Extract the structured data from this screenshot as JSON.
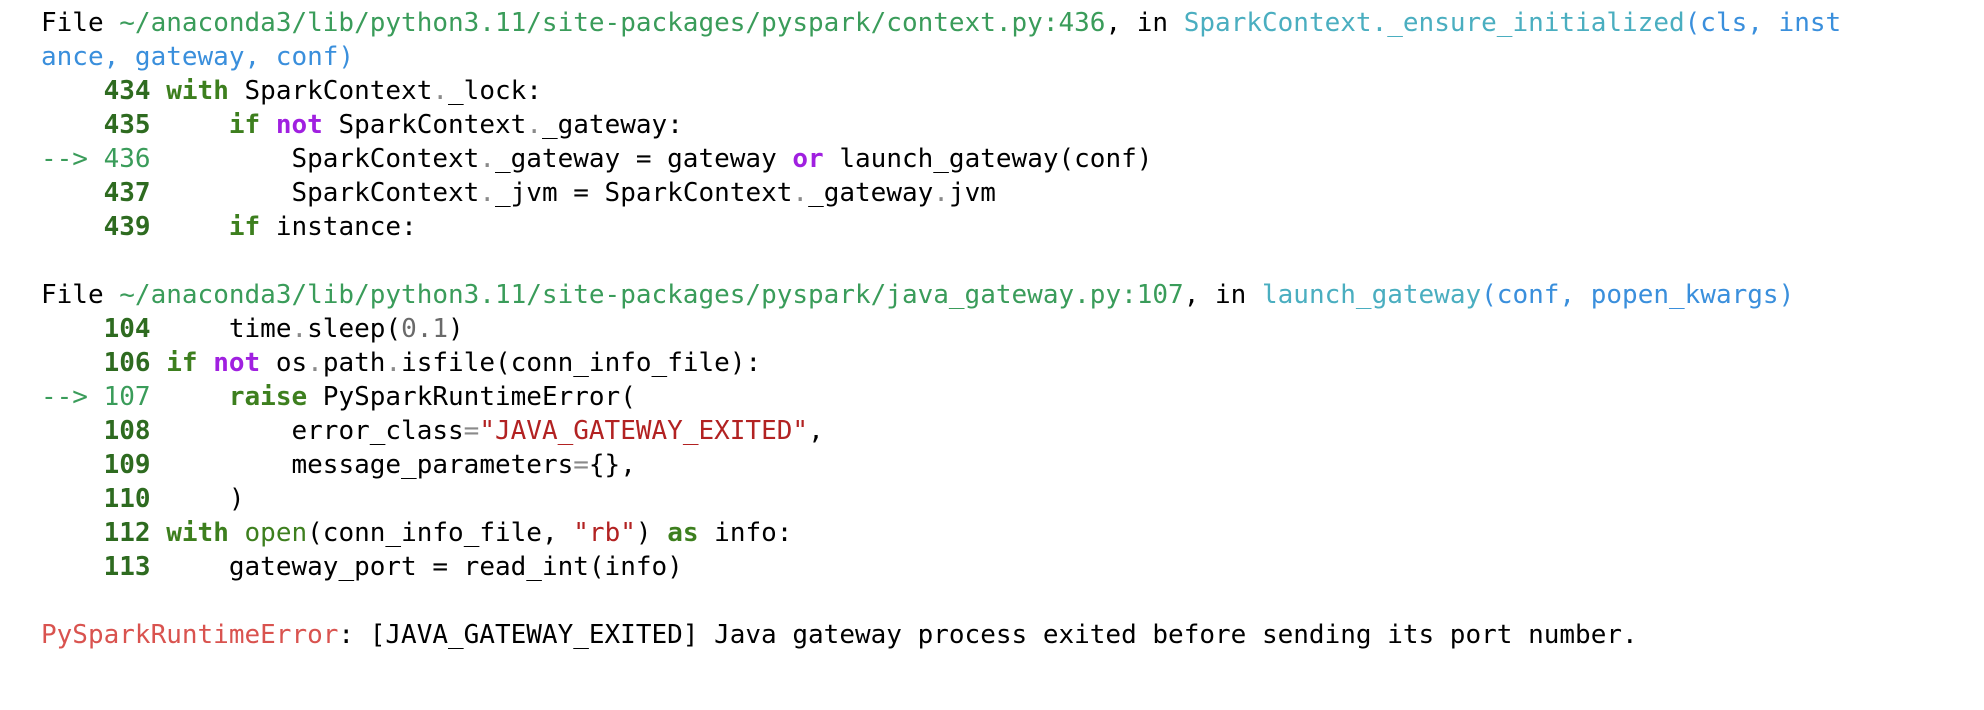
{
  "frame1": {
    "file_label": "File",
    "path": "~/anaconda3/lib/python3.11/site-packages/pyspark/context.py:436",
    "in_label": ", in",
    "func": "SparkContext._ensure_initialized",
    "args_part1": "(cls, inst",
    "args_part2": "ance, gateway, conf)",
    "lines": {
      "l434": {
        "no": "434",
        "kw": "with",
        "rest": " SparkContext",
        "dot": ".",
        "rest2": "_lock:"
      },
      "l435": {
        "no": "435",
        "kw": "if",
        "kw2": "not",
        "rest": " SparkContext",
        "dot": ".",
        "rest2": "_gateway:"
      },
      "l436": {
        "arrow": "--> 436",
        "a": "SparkContext",
        "dot": ".",
        "b": "_gateway = gateway",
        "kw": "or",
        "c": " launch_gateway(conf)"
      },
      "l437": {
        "no": "437",
        "a": "SparkContext",
        "dot1": ".",
        "b": "_jvm = SparkContext",
        "dot2": ".",
        "c": "_gateway",
        "dot3": ".",
        "d": "jvm"
      },
      "l439": {
        "no": "439",
        "kw": "if",
        "rest": " instance:"
      }
    }
  },
  "frame2": {
    "file_label": "File",
    "path": "~/anaconda3/lib/python3.11/site-packages/pyspark/java_gateway.py:107",
    "in_label": ", in",
    "func": "launch_gateway",
    "args": "(conf, popen_kwargs)",
    "lines": {
      "l104": {
        "no": "104",
        "a": "time",
        "dot": ".",
        "b": "sleep(",
        "num": "0.1",
        "c": ")"
      },
      "l106": {
        "no": "106",
        "kw": "if",
        "kw2": "not",
        "a": " os",
        "dot1": ".",
        "b": "path",
        "dot2": ".",
        "c": "isfile(conn_info_file):"
      },
      "l107": {
        "arrow": "--> 107",
        "kw": "raise",
        "rest": " PySparkRuntimeError("
      },
      "l108": {
        "no": "108",
        "a": "error_class",
        "eq": "=",
        "str": "\"JAVA_GATEWAY_EXITED\"",
        "b": ","
      },
      "l109": {
        "no": "109",
        "a": "message_parameters",
        "eq": "=",
        "b": "{},"
      },
      "l110": {
        "no": "110",
        "a": ")"
      },
      "l112": {
        "no": "112",
        "kw": "with",
        "builtin": "open",
        "a": "(conn_info_file, ",
        "str": "\"rb\"",
        "b": ") ",
        "kw2": "as",
        "c": " info:"
      },
      "l113": {
        "no": "113",
        "a": "gateway_port = read_int(info)"
      }
    }
  },
  "error": {
    "name": "PySparkRuntimeError",
    "message": ": [JAVA_GATEWAY_EXITED] Java gateway process exited before sending its port number."
  },
  "colors": {
    "path": "#3a9c5a",
    "function": "#4aaec0",
    "args": "#3a8fdc",
    "keyword": "#3d7f1e",
    "keyword_purple": "#a020e0",
    "string": "#b22222",
    "error_name": "#d9534f"
  }
}
